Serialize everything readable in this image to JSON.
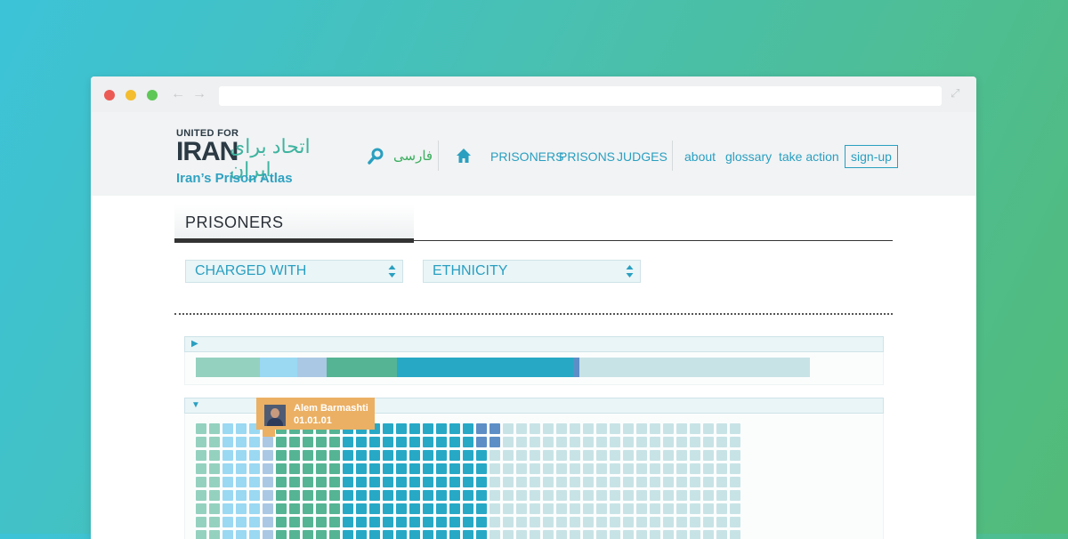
{
  "browser": {
    "back_icon": "arrow-left-icon",
    "forward_icon": "arrow-right-icon",
    "expand_icon": "expand-icon",
    "url": ""
  },
  "logo": {
    "line1": "UNITED FOR",
    "line2": "IRAN",
    "calligraphy": "اتحاد برای ایران",
    "subtitle": "Iran’s Prison Atlas"
  },
  "header": {
    "search_icon": "search-icon",
    "language": "فارسی",
    "home_icon": "home-icon",
    "nav_main": [
      "PRISONERS",
      "PRISONS",
      "JUDGES"
    ],
    "nav_secondary": [
      "about",
      "glossary",
      "take action"
    ],
    "signup": "sign-up"
  },
  "section": {
    "title": "PRISONERS"
  },
  "filters": [
    {
      "label": "CHARGED WITH"
    },
    {
      "label": "ETHNICITY"
    }
  ],
  "colors": {
    "accent": "#2a9fc0",
    "groups": [
      "#95d1bf",
      "#9bd8f2",
      "#aac8e4",
      "#55b494",
      "#27a9c6",
      "#5d8fc6",
      "#c8e3e6"
    ]
  },
  "summary_bar": {
    "toggle_icon": "caret-right-icon",
    "segment_fractions": [
      0.104,
      0.061,
      0.048,
      0.114,
      0.287,
      0.01,
      0.376
    ]
  },
  "prisoner_grid": {
    "toggle_icon": "caret-down-icon",
    "tooltip": {
      "avatar_icon": "prisoner-avatar-icon",
      "name": "Alem Barmashti",
      "date": "01.01.01"
    }
  }
}
